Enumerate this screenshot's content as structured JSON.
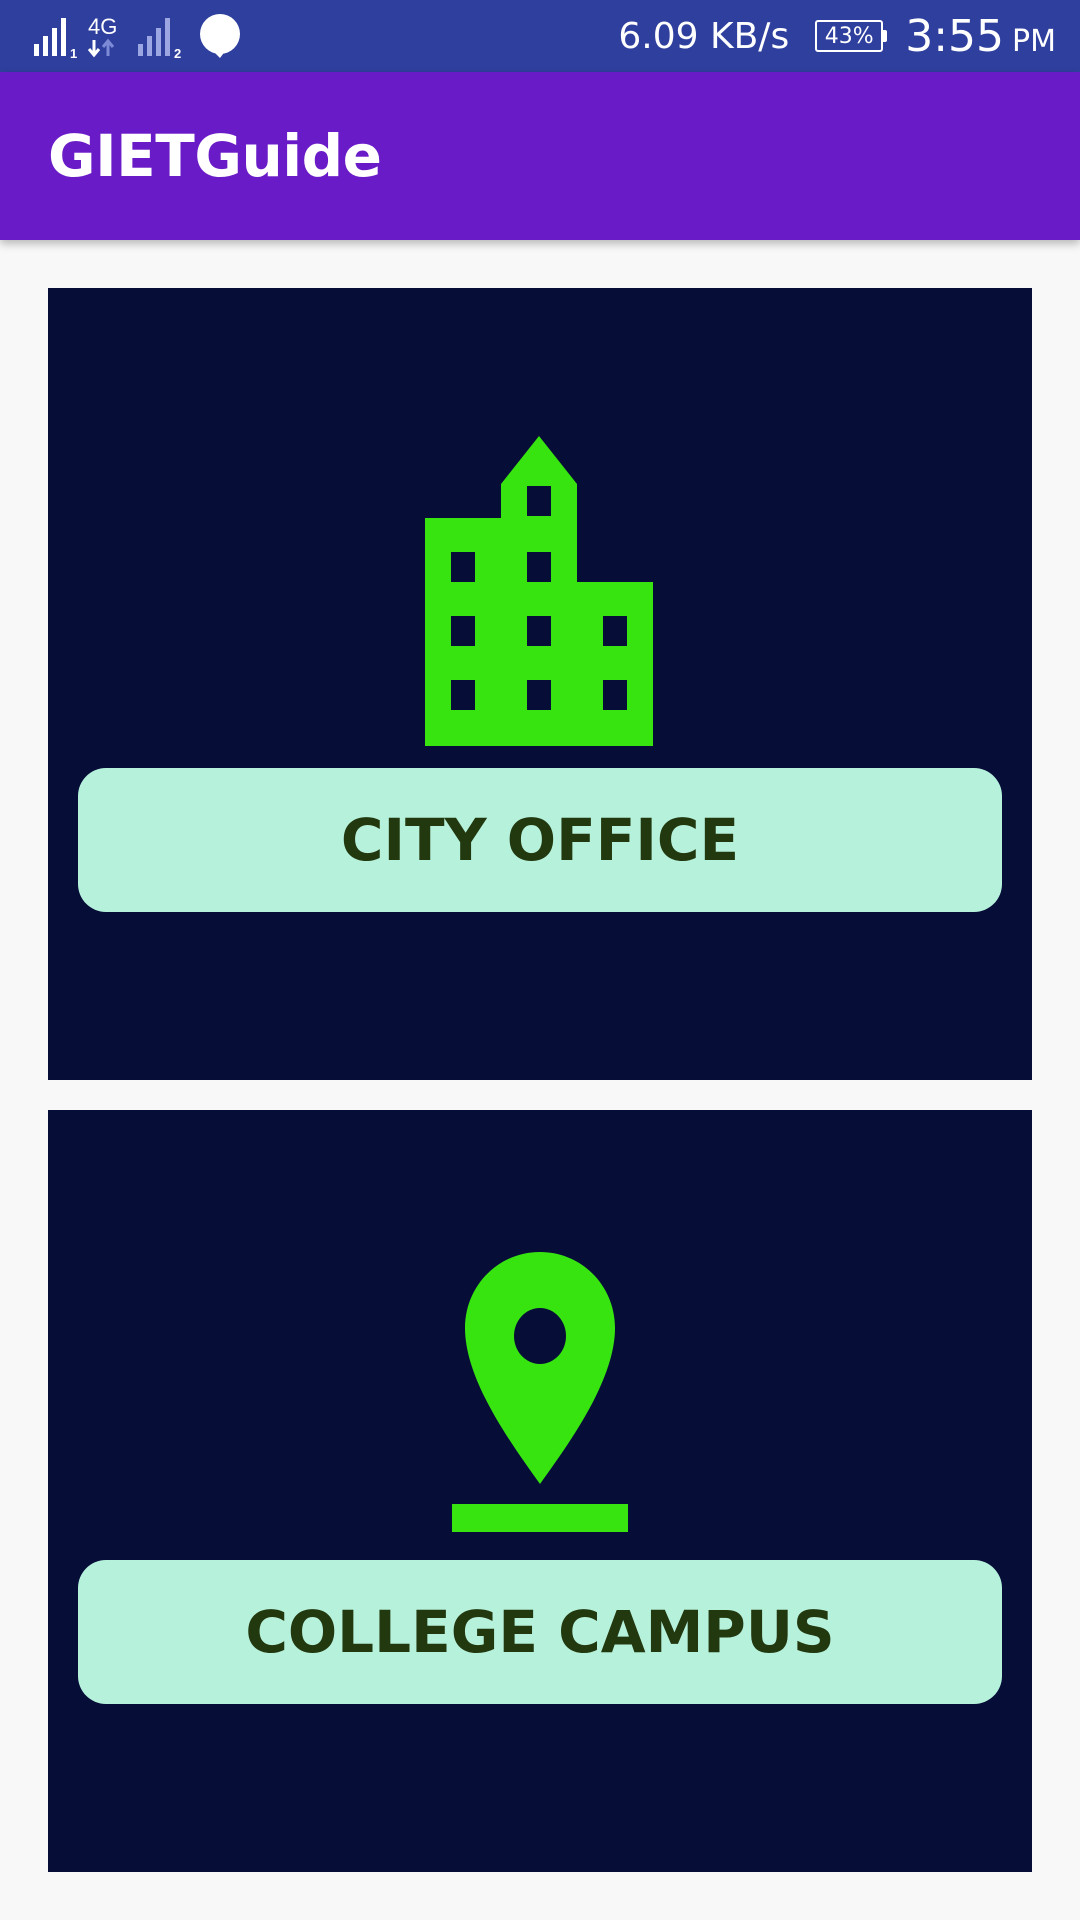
{
  "status_bar": {
    "sim1_label": "1",
    "network_type": "4G",
    "sim2_label": "2",
    "net_speed": "6.09 KB/s",
    "battery": "43%",
    "time": "3:55",
    "ampm": "PM"
  },
  "app_bar": {
    "title": "GIETGuide"
  },
  "cards": [
    {
      "icon": "building-icon",
      "label": "CITY OFFICE"
    },
    {
      "icon": "map-pin-icon",
      "label": "COLLEGE CAMPUS"
    }
  ],
  "colors": {
    "status_bar": "#2f3f9e",
    "app_bar": "#6a1bc8",
    "card_background": "#060e38",
    "icon_green": "#38e40f",
    "button_background": "#b6f1dc",
    "button_text": "#22380e",
    "page_background": "#f8f8f8"
  }
}
